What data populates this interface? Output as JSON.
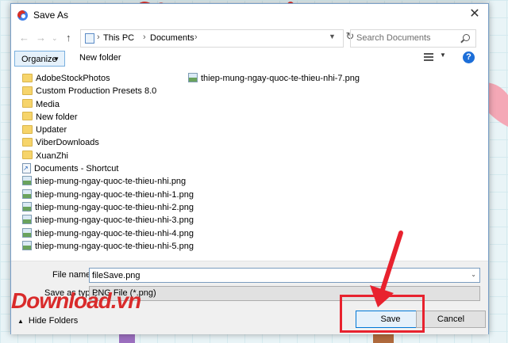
{
  "window": {
    "title": "Save As"
  },
  "address": {
    "crumbs": [
      "This PC",
      "Documents"
    ]
  },
  "search": {
    "placeholder": "Search Documents"
  },
  "toolbar": {
    "organize_label": "Organize",
    "new_folder_label": "New folder",
    "help": "?"
  },
  "files_left": [
    {
      "name": "AdobeStockPhotos",
      "kind": "folder"
    },
    {
      "name": "Custom Production Presets 8.0",
      "kind": "folder"
    },
    {
      "name": "Media",
      "kind": "folder"
    },
    {
      "name": "New folder",
      "kind": "folder"
    },
    {
      "name": "Updater",
      "kind": "folder"
    },
    {
      "name": "ViberDownloads",
      "kind": "folder"
    },
    {
      "name": "XuanZhi",
      "kind": "folder"
    },
    {
      "name": "Documents - Shortcut",
      "kind": "shortcut"
    },
    {
      "name": "thiep-mung-ngay-quoc-te-thieu-nhi.png",
      "kind": "image"
    },
    {
      "name": "thiep-mung-ngay-quoc-te-thieu-nhi-1.png",
      "kind": "image"
    },
    {
      "name": "thiep-mung-ngay-quoc-te-thieu-nhi-2.png",
      "kind": "image"
    },
    {
      "name": "thiep-mung-ngay-quoc-te-thieu-nhi-3.png",
      "kind": "image"
    },
    {
      "name": "thiep-mung-ngay-quoc-te-thieu-nhi-4.png",
      "kind": "image"
    },
    {
      "name": "thiep-mung-ngay-quoc-te-thieu-nhi-5.png",
      "kind": "image"
    }
  ],
  "files_right": [
    {
      "name": "thiep-mung-ngay-quoc-te-thieu-nhi-7.png",
      "kind": "image"
    }
  ],
  "form": {
    "file_name_label": "File name:",
    "file_name_value": "fileSave.png",
    "save_type_label": "Save as type:",
    "save_type_value": "PNG File (*.png)"
  },
  "footer": {
    "hide_folders_label": "Hide Folders",
    "save_label": "Save",
    "cancel_label": "Cancel"
  },
  "watermark": {
    "text": "Download.vn"
  },
  "colors": {
    "accent": "#0078d7",
    "highlight": "#e8222e",
    "folder": "#f6d46b"
  }
}
